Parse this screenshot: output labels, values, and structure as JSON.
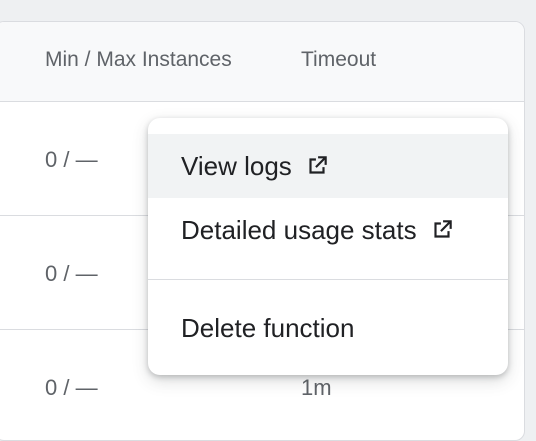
{
  "table": {
    "columns": {
      "instances": "Min / Max Instances",
      "timeout": "Timeout"
    },
    "rows": [
      {
        "instances": "0 / —",
        "timeout": ""
      },
      {
        "instances": "0 / —",
        "timeout": ""
      },
      {
        "instances": "0 / —",
        "timeout": "1m"
      }
    ]
  },
  "menu": {
    "items": [
      {
        "label": "View logs",
        "icon": "open-in-new-icon"
      },
      {
        "label": "Detailed usage stats",
        "icon": "open-in-new-icon"
      },
      {
        "label": "Delete function"
      }
    ]
  },
  "colors": {
    "text_primary": "#202124",
    "text_secondary": "#5f6368",
    "border": "#dadce0",
    "hover": "#f1f3f4"
  }
}
